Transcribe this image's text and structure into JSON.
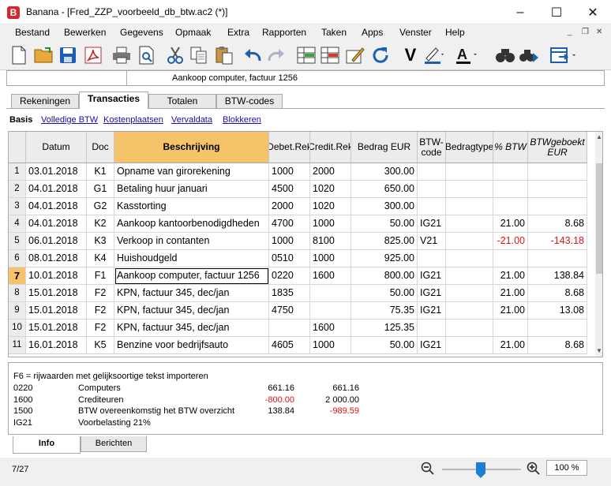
{
  "window": {
    "title": "Banana - [Fred_ZZP_voorbeeld_db_btw.ac2 (*)]",
    "logo": "B"
  },
  "menu": [
    "Bestand",
    "Bewerken",
    "Gegevens",
    "Opmaak",
    "Extra",
    "Rapporten",
    "Taken",
    "Apps",
    "Venster",
    "Help"
  ],
  "cell_editor": {
    "text": "Aankoop computer, factuur 1256"
  },
  "tabs": [
    "Rekeningen",
    "Transacties",
    "Totalen",
    "BTW-codes"
  ],
  "views": {
    "current": "Basis",
    "links": [
      "Volledige BTW",
      "Kostenplaatsen",
      "Vervaldata",
      "Blokkeren"
    ]
  },
  "columns": [
    "Datum",
    "Doc",
    "Beschrijving",
    "Debet.Rek",
    "Credit.Rek",
    "Bedrag EUR",
    "BTW-code",
    "Bedragtype",
    "% BTW",
    "BTWgeboekt EUR"
  ],
  "rows": [
    {
      "n": "1",
      "datum": "03.01.2018",
      "doc": "K1",
      "beschr": "Opname van girorekening",
      "debet": "1000",
      "credit": "2000",
      "bedrag": "300.00",
      "btw": "",
      "type": "",
      "pct": "",
      "geboekt": ""
    },
    {
      "n": "2",
      "datum": "04.01.2018",
      "doc": "G1",
      "beschr": "Betaling huur januari",
      "debet": "4500",
      "credit": "1020",
      "bedrag": "650.00",
      "btw": "",
      "type": "",
      "pct": "",
      "geboekt": ""
    },
    {
      "n": "3",
      "datum": "04.01.2018",
      "doc": "G2",
      "beschr": "Kasstorting",
      "debet": "2000",
      "credit": "1020",
      "bedrag": "300.00",
      "btw": "",
      "type": "",
      "pct": "",
      "geboekt": ""
    },
    {
      "n": "4",
      "datum": "04.01.2018",
      "doc": "K2",
      "beschr": "Aankoop kantoorbenodigdheden",
      "debet": "4700",
      "credit": "1000",
      "bedrag": "50.00",
      "btw": "IG21",
      "type": "",
      "pct": "21.00",
      "geboekt": "8.68"
    },
    {
      "n": "5",
      "datum": "06.01.2018",
      "doc": "K3",
      "beschr": "Verkoop in contanten",
      "debet": "1000",
      "credit": "8100",
      "bedrag": "825.00",
      "btw": "V21",
      "type": "",
      "pct": "-21.00",
      "geboekt": "-143.18"
    },
    {
      "n": "6",
      "datum": "08.01.2018",
      "doc": "K4",
      "beschr": "Huishoudgeld",
      "debet": "0510",
      "credit": "1000",
      "bedrag": "925.00",
      "btw": "",
      "type": "",
      "pct": "",
      "geboekt": ""
    },
    {
      "n": "7",
      "datum": "10.01.2018",
      "doc": "F1",
      "beschr": "Aankoop computer, factuur 1256",
      "debet": "0220",
      "credit": "1600",
      "bedrag": "800.00",
      "btw": "IG21",
      "type": "",
      "pct": "21.00",
      "geboekt": "138.84"
    },
    {
      "n": "8",
      "datum": "15.01.2018",
      "doc": "F2",
      "beschr": "KPN, factuur 345, dec/jan",
      "debet": "1835",
      "credit": "",
      "bedrag": "50.00",
      "btw": "IG21",
      "type": "",
      "pct": "21.00",
      "geboekt": "8.68"
    },
    {
      "n": "9",
      "datum": "15.01.2018",
      "doc": "F2",
      "beschr": "KPN, factuur 345, dec/jan",
      "debet": "4750",
      "credit": "",
      "bedrag": "75.35",
      "btw": "IG21",
      "type": "",
      "pct": "21.00",
      "geboekt": "13.08"
    },
    {
      "n": "10",
      "datum": "15.01.2018",
      "doc": "F2",
      "beschr": "KPN, factuur 345, dec/jan",
      "debet": "",
      "credit": "1600",
      "bedrag": "125.35",
      "btw": "",
      "type": "",
      "pct": "",
      "geboekt": ""
    },
    {
      "n": "11",
      "datum": "16.01.2018",
      "doc": "K5",
      "beschr": "Benzine voor bedrijfsauto",
      "debet": "4605",
      "credit": "1000",
      "bedrag": "50.00",
      "btw": "IG21",
      "type": "",
      "pct": "21.00",
      "geboekt": "8.68"
    }
  ],
  "info": {
    "hint": "F6 = rijwaarden met gelijksoortige tekst importeren",
    "lines": [
      {
        "code": "0220",
        "name": "Computers",
        "a": "661.16",
        "b": "661.16"
      },
      {
        "code": "1600",
        "name": "Crediteuren",
        "a": "-800.00",
        "b": "2 000.00"
      },
      {
        "code": "1500",
        "name": "BTW overeenkomstig het BTW overzicht",
        "a": "138.84",
        "b": "-989.59"
      },
      {
        "code": "IG21",
        "name": "Voorbelasting 21%",
        "a": "",
        "b": ""
      }
    ]
  },
  "bottom_tabs": [
    "Info",
    "Berichten"
  ],
  "status": {
    "position": "7/27",
    "zoom": "100 %"
  },
  "colors": {
    "active_header": "#f5c46a",
    "negative": "#e01010",
    "link": "#1a0dab"
  }
}
